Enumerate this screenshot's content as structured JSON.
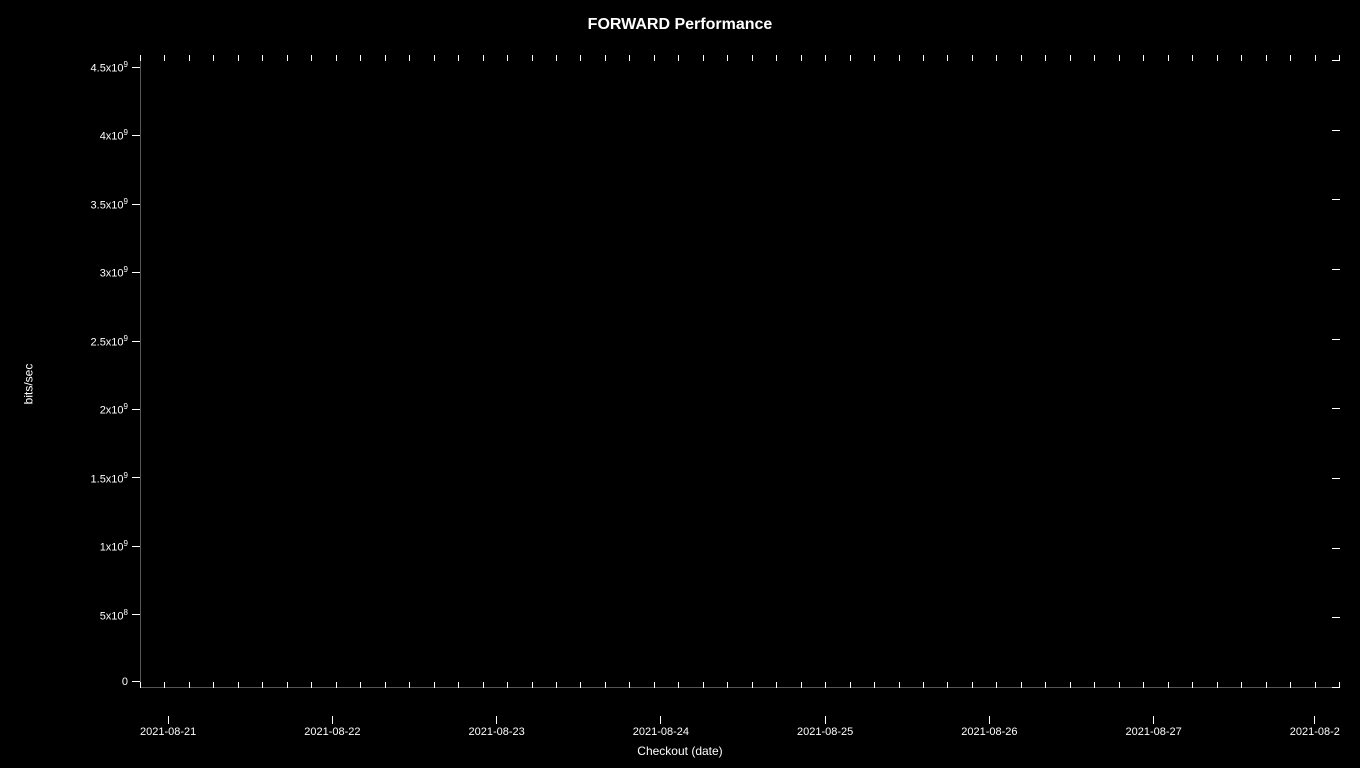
{
  "chart": {
    "title": "FORWARD Performance",
    "y_axis_label": "bits/sec",
    "x_axis_label": "Checkout (date)",
    "y_ticks": [
      {
        "label": "4.5x10",
        "sup": "9"
      },
      {
        "label": "4x10",
        "sup": "9"
      },
      {
        "label": "3.5x10",
        "sup": "9"
      },
      {
        "label": "3x10",
        "sup": "9"
      },
      {
        "label": "2.5x10",
        "sup": "9"
      },
      {
        "label": "2x10",
        "sup": "9"
      },
      {
        "label": "1.5x10",
        "sup": "9"
      },
      {
        "label": "1x10",
        "sup": "9"
      },
      {
        "label": "5x10",
        "sup": "8"
      },
      {
        "label": "0",
        "sup": ""
      }
    ],
    "x_ticks": [
      "2021-08-21",
      "2021-08-22",
      "2021-08-23",
      "2021-08-24",
      "2021-08-25",
      "2021-08-26",
      "2021-08-27",
      "2021-08-2"
    ]
  }
}
